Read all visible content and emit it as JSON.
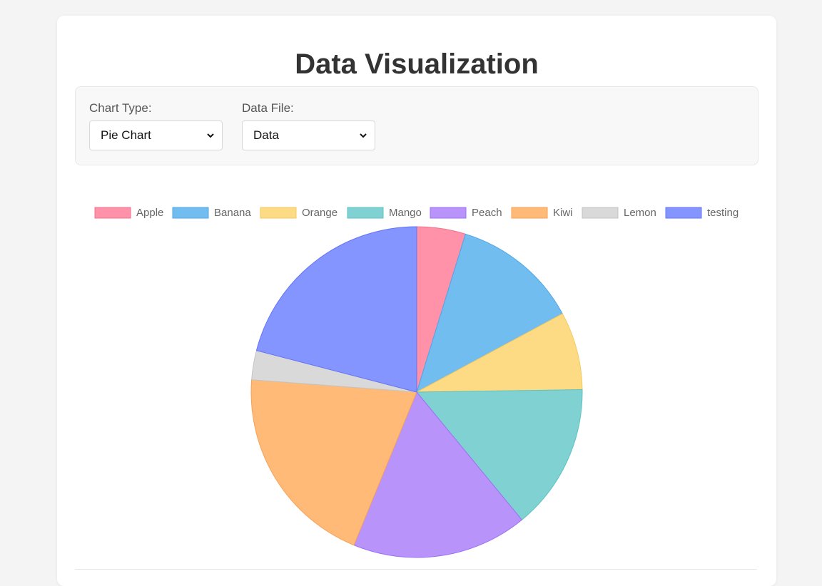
{
  "page": {
    "title": "Data Visualization"
  },
  "controls": {
    "chart_type": {
      "label": "Chart Type:",
      "value": "Pie Chart"
    },
    "data_file": {
      "label": "Data File:",
      "value": "Data"
    }
  },
  "chart_data": {
    "type": "pie",
    "legend_position": "top",
    "categories": [
      "Apple",
      "Banana",
      "Orange",
      "Mango",
      "Peach",
      "Kiwi",
      "Lemon",
      "testing"
    ],
    "values": [
      5,
      13,
      8,
      15,
      18,
      21,
      3,
      22
    ],
    "colors": [
      "#ff91a8",
      "#72bdf0",
      "#fdda84",
      "#80d2d2",
      "#b894fa",
      "#ffba78",
      "#d9d9d9",
      "#8595ff"
    ],
    "borders": [
      "#f0718e",
      "#4fa6e6",
      "#f3c960",
      "#5ec2c2",
      "#9d6ff5",
      "#f5a25a",
      "#c4c4c4",
      "#6474f5"
    ]
  }
}
